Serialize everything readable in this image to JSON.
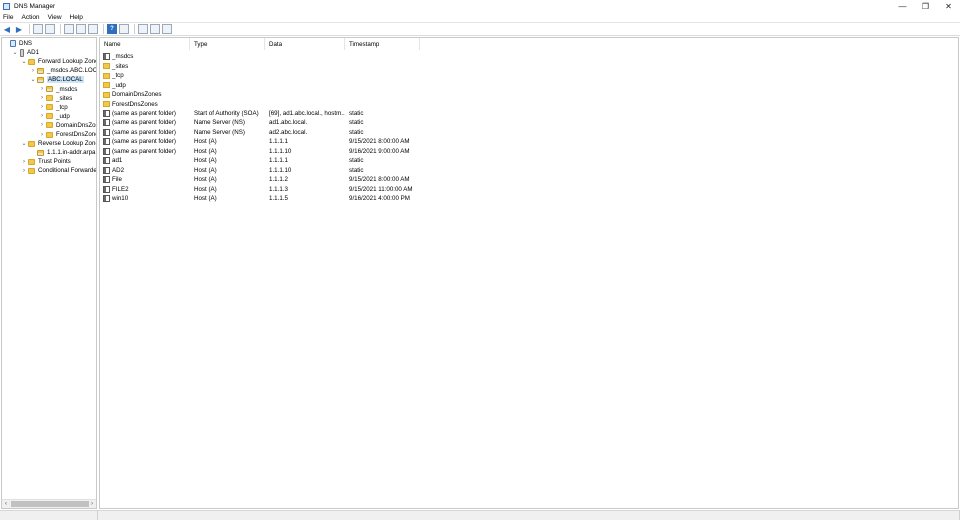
{
  "window": {
    "title": "DNS Manager",
    "controls": {
      "minimize": "—",
      "restore": "❐",
      "close": "✕"
    }
  },
  "menu": [
    "File",
    "Action",
    "View",
    "Help"
  ],
  "toolbar": {
    "back": "◀",
    "forward": "▶",
    "help": "?"
  },
  "tree": {
    "items": [
      {
        "label": "DNS",
        "chevron": "",
        "icon": "dns-icon",
        "indent": 0
      },
      {
        "label": "AD1",
        "chevron": "⌄",
        "icon": "server-icon",
        "indent": 1
      },
      {
        "label": "Forward Lookup Zones",
        "chevron": "⌄",
        "icon": "folder-icon",
        "indent": 2
      },
      {
        "label": "_msdcs.ABC.LOCAL",
        "chevron": "›",
        "icon": "zone-icon",
        "indent": 3
      },
      {
        "label": "ABC.LOCAL",
        "chevron": "⌄",
        "icon": "zone-icon",
        "indent": 3,
        "selected": true
      },
      {
        "label": "_msdcs",
        "chevron": "›",
        "icon": "zone-icon",
        "indent": 4
      },
      {
        "label": "_sites",
        "chevron": "›",
        "icon": "folder-icon",
        "indent": 4
      },
      {
        "label": "_tcp",
        "chevron": "›",
        "icon": "folder-icon",
        "indent": 4
      },
      {
        "label": "_udp",
        "chevron": "›",
        "icon": "folder-icon",
        "indent": 4
      },
      {
        "label": "DomainDnsZones",
        "chevron": "›",
        "icon": "folder-icon",
        "indent": 4
      },
      {
        "label": "ForestDnsZones",
        "chevron": "›",
        "icon": "folder-icon",
        "indent": 4
      },
      {
        "label": "Reverse Lookup Zones",
        "chevron": "⌄",
        "icon": "folder-icon",
        "indent": 2
      },
      {
        "label": "1.1.1.in-addr.arpa",
        "chevron": "",
        "icon": "zone-icon",
        "indent": 3
      },
      {
        "label": "Trust Points",
        "chevron": "›",
        "icon": "folder-icon",
        "indent": 2
      },
      {
        "label": "Conditional Forwarders",
        "chevron": "›",
        "icon": "folder-icon",
        "indent": 2
      }
    ],
    "scroll_left": "‹",
    "scroll_right": "›"
  },
  "list": {
    "columns": [
      "Name",
      "Type",
      "Data",
      "Timestamp"
    ],
    "rows": [
      {
        "name": "_msdcs",
        "type": "",
        "data": "",
        "timestamp": "",
        "icon": "record-icon"
      },
      {
        "name": "_sites",
        "type": "",
        "data": "",
        "timestamp": "",
        "icon": "folder-icon"
      },
      {
        "name": "_tcp",
        "type": "",
        "data": "",
        "timestamp": "",
        "icon": "folder-icon"
      },
      {
        "name": "_udp",
        "type": "",
        "data": "",
        "timestamp": "",
        "icon": "folder-icon"
      },
      {
        "name": "DomainDnsZones",
        "type": "",
        "data": "",
        "timestamp": "",
        "icon": "folder-icon"
      },
      {
        "name": "ForestDnsZones",
        "type": "",
        "data": "",
        "timestamp": "",
        "icon": "folder-icon"
      },
      {
        "name": "(same as parent folder)",
        "type": "Start of Authority (SOA)",
        "data": "[69], ad1.abc.local., hostm...",
        "timestamp": "static",
        "icon": "record-icon"
      },
      {
        "name": "(same as parent folder)",
        "type": "Name Server (NS)",
        "data": "ad1.abc.local.",
        "timestamp": "static",
        "icon": "record-icon"
      },
      {
        "name": "(same as parent folder)",
        "type": "Name Server (NS)",
        "data": "ad2.abc.local.",
        "timestamp": "static",
        "icon": "record-icon"
      },
      {
        "name": "(same as parent folder)",
        "type": "Host (A)",
        "data": "1.1.1.1",
        "timestamp": "9/15/2021 8:00:00 AM",
        "icon": "record-icon"
      },
      {
        "name": "(same as parent folder)",
        "type": "Host (A)",
        "data": "1.1.1.10",
        "timestamp": "9/16/2021 9:00:00 AM",
        "icon": "record-icon"
      },
      {
        "name": "ad1",
        "type": "Host (A)",
        "data": "1.1.1.1",
        "timestamp": "static",
        "icon": "record-icon"
      },
      {
        "name": "AD2",
        "type": "Host (A)",
        "data": "1.1.1.10",
        "timestamp": "static",
        "icon": "record-icon"
      },
      {
        "name": "File",
        "type": "Host (A)",
        "data": "1.1.1.2",
        "timestamp": "9/15/2021 8:00:00 AM",
        "icon": "record-icon"
      },
      {
        "name": "FILE2",
        "type": "Host (A)",
        "data": "1.1.1.3",
        "timestamp": "9/15/2021 11:00:00 AM",
        "icon": "record-icon"
      },
      {
        "name": "win10",
        "type": "Host (A)",
        "data": "1.1.1.5",
        "timestamp": "9/16/2021 4:00:00 PM",
        "icon": "record-icon"
      }
    ]
  }
}
